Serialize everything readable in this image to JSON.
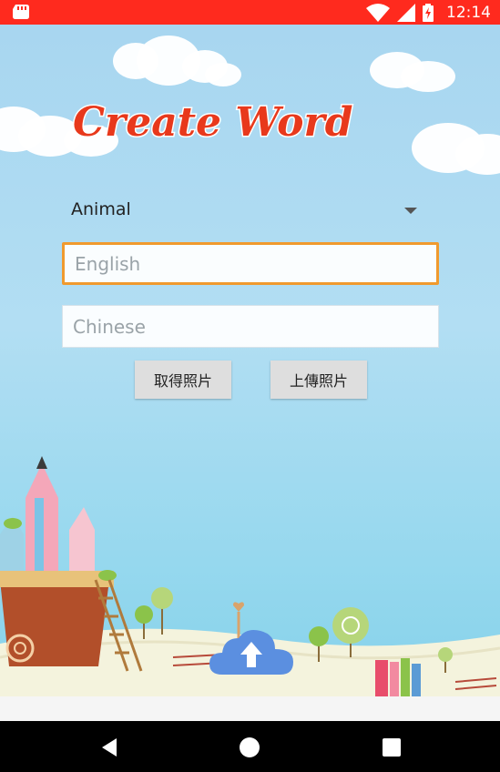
{
  "status_bar": {
    "time": "12:14",
    "icons": [
      "sd-card-icon",
      "wifi-icon",
      "signal-icon",
      "battery-charging-icon"
    ]
  },
  "app": {
    "logo_text": "Create Word"
  },
  "form": {
    "category": {
      "selected": "Animal"
    },
    "english": {
      "placeholder": "English",
      "value": ""
    },
    "chinese": {
      "placeholder": "Chinese",
      "value": ""
    },
    "get_photo_label": "取得照片",
    "upload_photo_label": "上傳照片"
  },
  "upload_button_icon": "cloud-upload-icon",
  "nav_bar": {
    "icons": [
      "back-icon",
      "home-icon",
      "recents-icon"
    ]
  },
  "colors": {
    "status_bar": "#ff2a1e",
    "focus_border": "#f09a2e",
    "upload_cloud": "#5b8fe0",
    "logo_text": "#e8391c"
  }
}
